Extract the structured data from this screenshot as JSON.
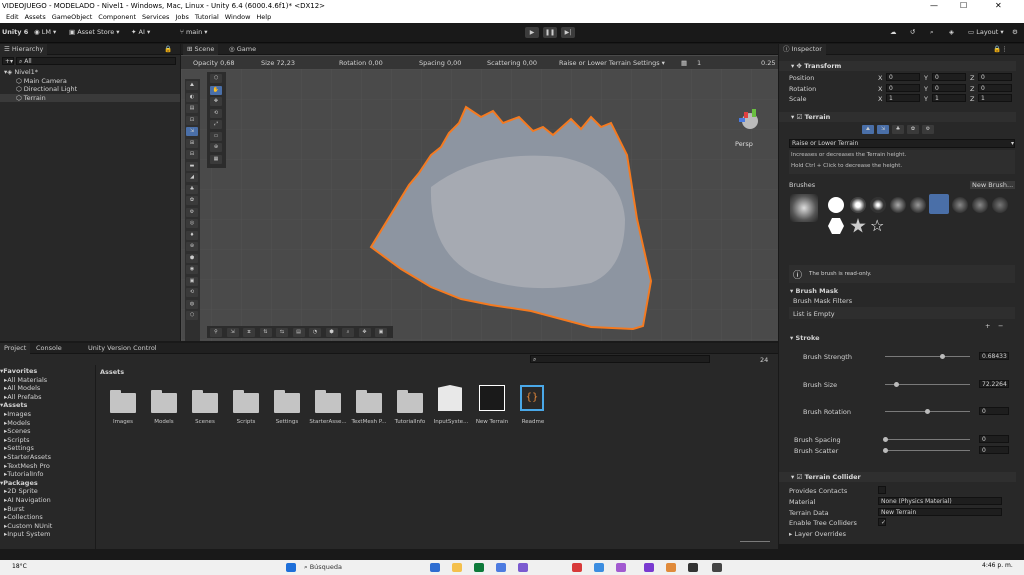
{
  "window": {
    "title": "VIDEOJUEGO - MODELADO - Nivel1 - Windows, Mac, Linux - Unity 6.4 (6000.4.6f1)* <DX12>",
    "minimize": "—",
    "maximize": "☐",
    "close": "✕"
  },
  "menu": [
    "Edit",
    "Assets",
    "GameObject",
    "Component",
    "Services",
    "Jobs",
    "Tutorial",
    "Window",
    "Help"
  ],
  "toolbar": {
    "version": "Unity 6",
    "account": "LM",
    "asset_store": "Asset Store",
    "ai": "AI",
    "branch": "main",
    "layout": "Layout"
  },
  "hierarchy": {
    "tab": "Hierarchy",
    "search_placeholder": "All",
    "items": [
      {
        "label": "Nivel1*",
        "indent": 0,
        "selected": false
      },
      {
        "label": "Main Camera",
        "indent": 1,
        "selected": false
      },
      {
        "label": "Directional Light",
        "indent": 1,
        "selected": false
      },
      {
        "label": "Terrain",
        "indent": 1,
        "selected": true
      }
    ]
  },
  "scene": {
    "tabs": [
      "Scene",
      "Game"
    ],
    "overlay": {
      "opacity_label": "Opacity",
      "opacity_value": "0,68",
      "size_label": "Size",
      "size_value": "72,23",
      "rotation_label": "Rotation",
      "rotation_value": "0,00",
      "spacing_label": "Spacing",
      "spacing_value": "0,00",
      "scattering_label": "Scattering",
      "scattering_value": "0,00",
      "mode": "Raise or Lower Terrain Settings",
      "grid_value": "1",
      "snap_value": "0.25"
    },
    "persp": "Persp"
  },
  "inspector": {
    "tab": "Inspector",
    "transform": {
      "title": "Transform",
      "rows": [
        {
          "label": "Position",
          "x": "0",
          "y": "0",
          "z": "0"
        },
        {
          "label": "Rotation",
          "x": "0",
          "y": "0",
          "z": "0"
        },
        {
          "label": "Scale",
          "x": "1",
          "y": "1",
          "z": "1"
        }
      ]
    },
    "terrain": {
      "title": "Terrain",
      "tool": "Raise or Lower Terrain",
      "help1": "Increases or decreases the Terrain height.",
      "help2": "Hold Ctrl + Click to decrease the height.",
      "brushes_label": "Brushes",
      "new_brush": "New Brush...",
      "readonly": "The brush is read-only.",
      "brush_mask": "Brush Mask",
      "brush_mask_filters": "Brush Mask Filters",
      "list_empty": "List is Empty",
      "stroke": "Stroke",
      "params": [
        {
          "label": "Brush Strength",
          "value": "0.68433",
          "fraction": 0.68
        },
        {
          "label": "Brush Size",
          "value": "72.2264",
          "fraction": 0.14
        },
        {
          "label": "Brush Rotation",
          "value": "0",
          "fraction": 0.5
        },
        {
          "label": "Brush Spacing",
          "value": "0",
          "fraction": 0.0
        },
        {
          "label": "Brush Scatter",
          "value": "0",
          "fraction": 0.0
        }
      ]
    },
    "collider": {
      "title": "Terrain Collider",
      "provides_contacts": "Provides Contacts",
      "material_label": "Material",
      "material_value": "None (Physics Material)",
      "terrain_data_label": "Terrain Data",
      "terrain_data_value": "New Terrain",
      "enable_trees": "Enable Tree Colliders",
      "layer_overrides": "Layer Overrides"
    }
  },
  "project": {
    "tabs": [
      "Project",
      "Console",
      "Unity Version Control"
    ],
    "count": "24",
    "breadcrumb": "Assets",
    "tree": [
      {
        "label": "Favorites",
        "bold": true,
        "indent": 0
      },
      {
        "label": "All Materials",
        "bold": false,
        "indent": 1
      },
      {
        "label": "All Models",
        "bold": false,
        "indent": 1
      },
      {
        "label": "All Prefabs",
        "bold": false,
        "indent": 1
      },
      {
        "label": "Assets",
        "bold": true,
        "indent": 0
      },
      {
        "label": "Images",
        "bold": false,
        "indent": 1
      },
      {
        "label": "Models",
        "bold": false,
        "indent": 1
      },
      {
        "label": "Scenes",
        "bold": false,
        "indent": 1
      },
      {
        "label": "Scripts",
        "bold": false,
        "indent": 1
      },
      {
        "label": "Settings",
        "bold": false,
        "indent": 1
      },
      {
        "label": "StarterAssets",
        "bold": false,
        "indent": 1
      },
      {
        "label": "TextMesh Pro",
        "bold": false,
        "indent": 1
      },
      {
        "label": "TutorialInfo",
        "bold": false,
        "indent": 1
      },
      {
        "label": "Packages",
        "bold": true,
        "indent": 0
      },
      {
        "label": "2D Sprite",
        "bold": false,
        "indent": 1
      },
      {
        "label": "AI Navigation",
        "bold": false,
        "indent": 1
      },
      {
        "label": "Burst",
        "bold": false,
        "indent": 1
      },
      {
        "label": "Collections",
        "bold": false,
        "indent": 1
      },
      {
        "label": "Custom NUnit",
        "bold": false,
        "indent": 1
      },
      {
        "label": "Input System",
        "bold": false,
        "indent": 1
      }
    ],
    "assets": [
      "Images",
      "Models",
      "Scenes",
      "Scripts",
      "Settings",
      "StarterAsse...",
      "TextMesh P...",
      "TutorialInfo",
      "InputSyste...",
      "New Terrain",
      "Readme"
    ]
  },
  "taskbar": {
    "weather": "18°C",
    "search_placeholder": "Búsqueda",
    "time": "4:46 p. m."
  }
}
